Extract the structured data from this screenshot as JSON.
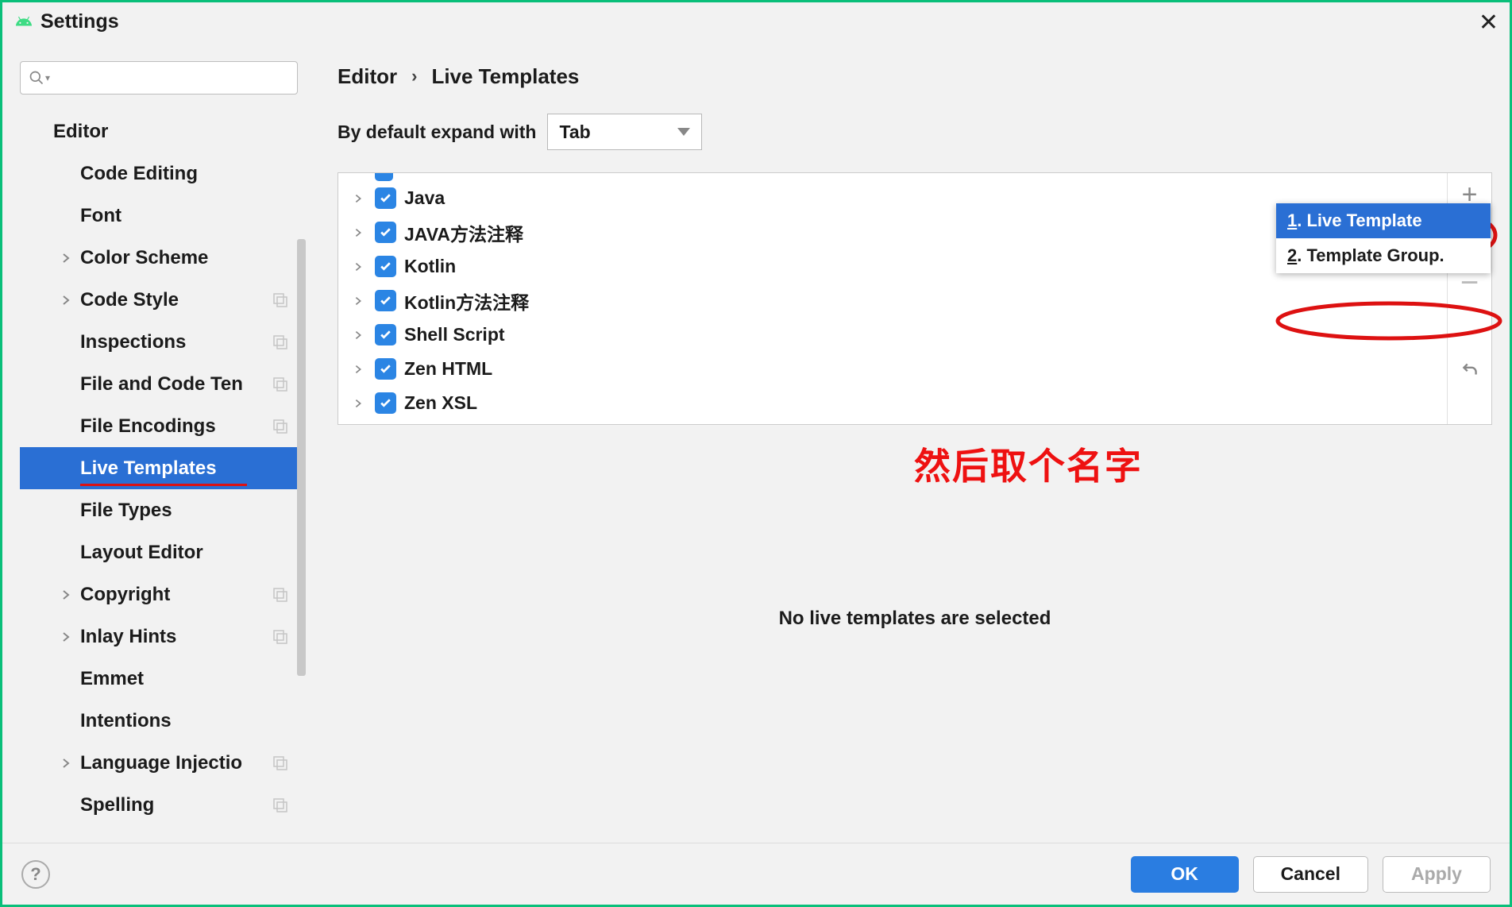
{
  "window": {
    "title": "Settings"
  },
  "sidebar": {
    "root": "Editor",
    "items": [
      {
        "label": "Code Editing",
        "arrow": false,
        "overlay": false,
        "sel": false
      },
      {
        "label": "Font",
        "arrow": false,
        "overlay": false,
        "sel": false
      },
      {
        "label": "Color Scheme",
        "arrow": true,
        "overlay": false,
        "sel": false
      },
      {
        "label": "Code Style",
        "arrow": true,
        "overlay": true,
        "sel": false
      },
      {
        "label": "Inspections",
        "arrow": false,
        "overlay": true,
        "sel": false
      },
      {
        "label": "File and Code Ten",
        "arrow": false,
        "overlay": true,
        "sel": false
      },
      {
        "label": "File Encodings",
        "arrow": false,
        "overlay": true,
        "sel": false
      },
      {
        "label": "Live Templates",
        "arrow": false,
        "overlay": false,
        "sel": true,
        "underline": true
      },
      {
        "label": "File Types",
        "arrow": false,
        "overlay": false,
        "sel": false
      },
      {
        "label": "Layout Editor",
        "arrow": false,
        "overlay": false,
        "sel": false
      },
      {
        "label": "Copyright",
        "arrow": true,
        "overlay": true,
        "sel": false
      },
      {
        "label": "Inlay Hints",
        "arrow": true,
        "overlay": true,
        "sel": false
      },
      {
        "label": "Emmet",
        "arrow": false,
        "overlay": false,
        "sel": false
      },
      {
        "label": "Intentions",
        "arrow": false,
        "overlay": false,
        "sel": false
      },
      {
        "label": "Language Injectio",
        "arrow": true,
        "overlay": true,
        "sel": false
      },
      {
        "label": "Spelling",
        "arrow": false,
        "overlay": true,
        "sel": false
      }
    ]
  },
  "breadcrumb": {
    "a": "Editor",
    "b": "Live Templates"
  },
  "expand": {
    "label": "By default expand with",
    "value": "Tab"
  },
  "templates": [
    {
      "label": "Java"
    },
    {
      "label": "JAVA方法注释"
    },
    {
      "label": "Kotlin"
    },
    {
      "label": "Kotlin方法注释"
    },
    {
      "label": "Shell Script"
    },
    {
      "label": "Zen HTML"
    },
    {
      "label": "Zen XSL"
    }
  ],
  "popup": {
    "item1_num": "1",
    "item1_text": ". Live Template",
    "item2_num": "2",
    "item2_text": ". Template Group."
  },
  "empty": "No live templates are selected",
  "annotation": "然后取个名字",
  "footer": {
    "ok": "OK",
    "cancel": "Cancel",
    "apply": "Apply"
  }
}
